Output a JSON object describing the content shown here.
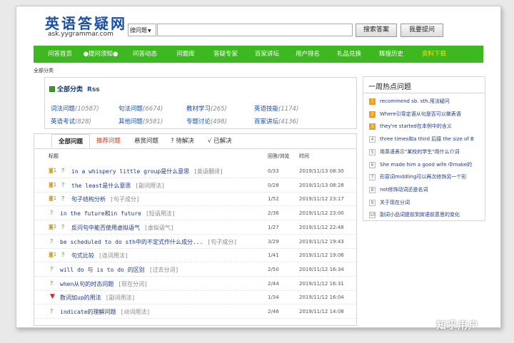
{
  "logo": {
    "cn": "英语答疑网",
    "en": "ask.yygrammar.com"
  },
  "search": {
    "type_label": "搜问题",
    "placeholder": "",
    "search_button": "搜索答案",
    "ask_button": "我要提问"
  },
  "nav": {
    "items": [
      "问答首页",
      "●提问须知●",
      "问答动态",
      "问题库",
      "答疑专家",
      "百家讲坛",
      "用户排名",
      "礼品兑换",
      "辉煌历史",
      "资料下载"
    ],
    "active_index": 9
  },
  "breadcrumb": "全部分类",
  "categories": {
    "title": "全部分类",
    "rss": "Rss",
    "items": [
      {
        "name": "词法问题",
        "count": "(10587)"
      },
      {
        "name": "句法问题",
        "count": "(6674)"
      },
      {
        "name": "教材学习",
        "count": "(265)"
      },
      {
        "name": "英语技能",
        "count": "(1174)"
      },
      {
        "name": "英语考试",
        "count": "(828)"
      },
      {
        "name": "其他问题",
        "count": "(9581)"
      },
      {
        "name": "专题讨论",
        "count": "(498)"
      },
      {
        "name": "百家讲坛",
        "count": "(4136)"
      }
    ]
  },
  "tabs": [
    {
      "label": "全部问题"
    },
    {
      "label": "推荐问题"
    },
    {
      "label": "悬赏问题"
    },
    {
      "label": "? 待解决"
    },
    {
      "label": "√ 已解决"
    }
  ],
  "list_header": {
    "title": "标题",
    "answers_views": "回答/浏览",
    "time": "时间"
  },
  "questions": [
    {
      "reward": "1",
      "title": "in a whispery little group是什么意思",
      "tag": "[英语翻译]",
      "count": "0/33",
      "time": "2019/11/13 08:30"
    },
    {
      "reward": "1",
      "title": "the least是什么意思",
      "tag": "[副词用法]",
      "count": "0/28",
      "time": "2019/11/13 08:28"
    },
    {
      "reward": "1",
      "title": "句子结构分析",
      "tag": "[句子成分]",
      "count": "1/52",
      "time": "2019/11/12 23:17"
    },
    {
      "reward": "",
      "title": "in the future和in future",
      "tag": "[短语用法]",
      "count": "2/36",
      "time": "2019/11/12 23:00"
    },
    {
      "reward": "2",
      "title": "反问句中能否使用虚拟语气",
      "tag": "[虚拟语气]",
      "count": "1/27",
      "time": "2019/11/12 22:48"
    },
    {
      "reward": "",
      "title": "be scheduled to do sth中的不定式作什么成分...",
      "tag": "[句子成分]",
      "count": "3/29",
      "time": "2019/11/12 19:43"
    },
    {
      "reward": "1",
      "title": "句式比较",
      "tag": "[连词用法]",
      "count": "1/41",
      "time": "2019/11/12 19:06"
    },
    {
      "reward": "",
      "title": "will do 与 is to do 的区别",
      "tag": "[过去分词]",
      "count": "2/50",
      "time": "2019/11/12 16:34"
    },
    {
      "reward": "",
      "title": "when从句的时态问题",
      "tag": "[现在分词]",
      "count": "2/44",
      "time": "2019/11/12 16:31"
    },
    {
      "reward": "",
      "title": "数词加up的用法",
      "tag": "[副词用法]",
      "count": "1/34",
      "time": "2019/11/12 16:04"
    },
    {
      "reward": "",
      "title": "indicate的理解问题",
      "tag": "[动词用法]",
      "count": "2/46",
      "time": "2019/11/12 14:08"
    }
  ],
  "hot": {
    "title": "一周热点问题",
    "items": [
      {
        "rank": "1",
        "text": "recommend sb. sth.用法疑问"
      },
      {
        "rank": "2",
        "text": "Where引导定语从句是否可以做表语"
      },
      {
        "rank": "3",
        "text": "they're started在本例中的含义"
      },
      {
        "rank": "4",
        "text": "three times和a third 后接 the size of B"
      },
      {
        "rank": "5",
        "text": "用英语表示\"某校的学生\"用什么介词"
      },
      {
        "rank": "6",
        "text": "She made him a good wife 中make的"
      },
      {
        "rank": "7",
        "text": "形容词middling可以再次修饰另一个形"
      },
      {
        "rank": "8",
        "text": "not修饰动词还是名词"
      },
      {
        "rank": "9",
        "text": "关于现在分词"
      },
      {
        "rank": "10",
        "text": "副词小品词提前到宾语前意思的变化"
      }
    ]
  },
  "watermark": "知乎用户"
}
